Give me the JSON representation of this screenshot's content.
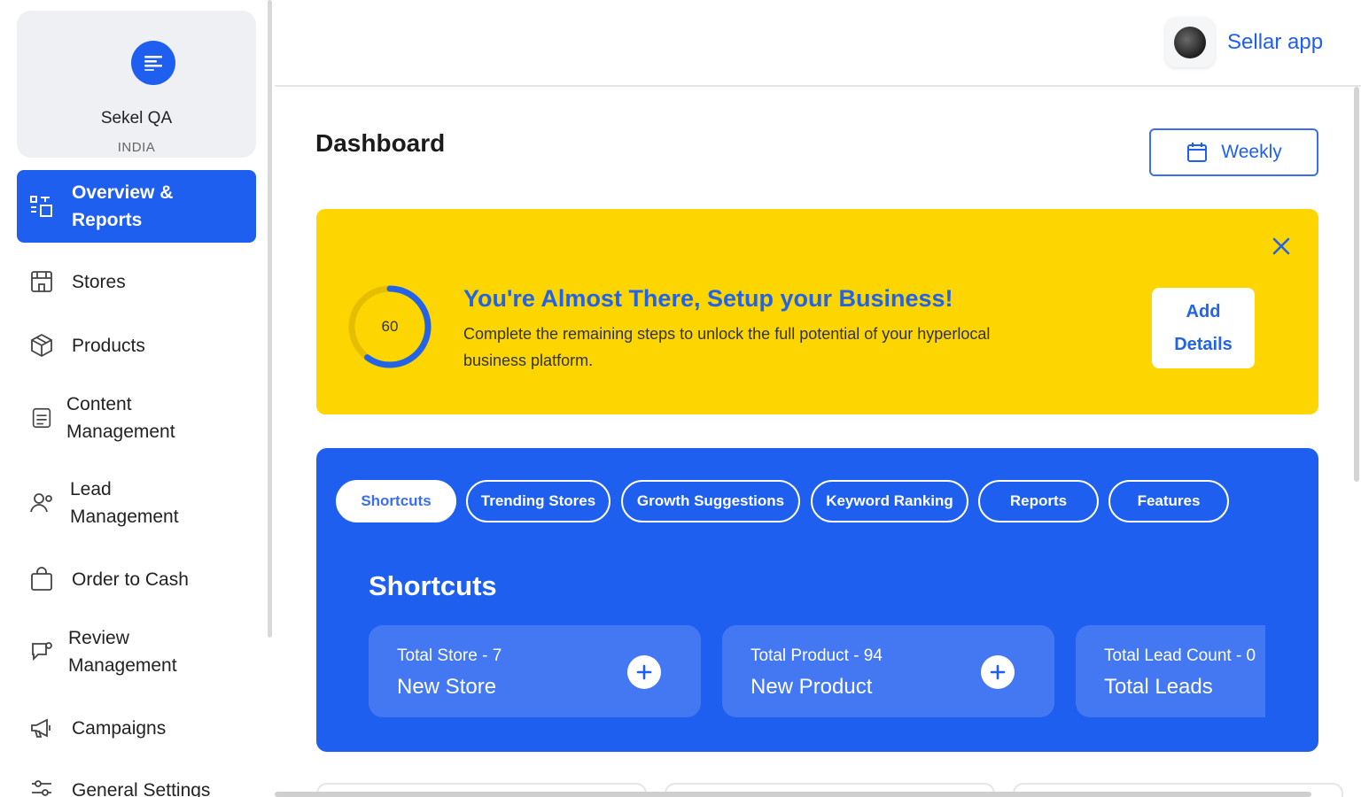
{
  "org": {
    "name": "Sekel QA",
    "country": "INDIA"
  },
  "sidebar": {
    "items": [
      {
        "label": "Overview & Reports",
        "icon": "overview-icon",
        "active": true
      },
      {
        "label": "Stores",
        "icon": "store-icon"
      },
      {
        "label": "Products",
        "icon": "box-icon"
      },
      {
        "label": "Content Management",
        "icon": "document-icon"
      },
      {
        "label": "Lead Management",
        "icon": "users-icon"
      },
      {
        "label": "Order to Cash",
        "icon": "shopping-bag-icon"
      },
      {
        "label": "Review Management",
        "icon": "review-icon"
      },
      {
        "label": "Campaigns",
        "icon": "megaphone-icon"
      },
      {
        "label": "General Settings",
        "icon": "settings-icon"
      }
    ]
  },
  "topbar": {
    "app_name": "Sellar app",
    "avatar_icon": "user-avatar"
  },
  "page": {
    "title": "Dashboard",
    "period_button": "Weekly"
  },
  "setup_banner": {
    "progress": 60,
    "progress_label": "60",
    "title": "You're Almost There, Setup your Business!",
    "text": "Complete the remaining steps to unlock the full potential of your hyperlocal business platform.",
    "action_label_line1": "Add",
    "action_label_line2": "Details",
    "close_icon": "close-icon"
  },
  "shortcuts": {
    "tabs": [
      {
        "label": "Shortcuts",
        "active": true
      },
      {
        "label": "Trending Stores"
      },
      {
        "label": "Growth Suggestions"
      },
      {
        "label": "Keyword Ranking"
      },
      {
        "label": "Reports"
      },
      {
        "label": "Features"
      }
    ],
    "heading": "Shortcuts",
    "cards": [
      {
        "count": "Total Store - 7",
        "title": "New Store"
      },
      {
        "count": "Total Product - 94",
        "title": "New Product"
      },
      {
        "count": "Total Lead Count - 0",
        "title": "Total Leads"
      }
    ]
  },
  "colors": {
    "primary": "#1f5ff0",
    "banner": "#fdd500",
    "progress": "#2263e8"
  }
}
